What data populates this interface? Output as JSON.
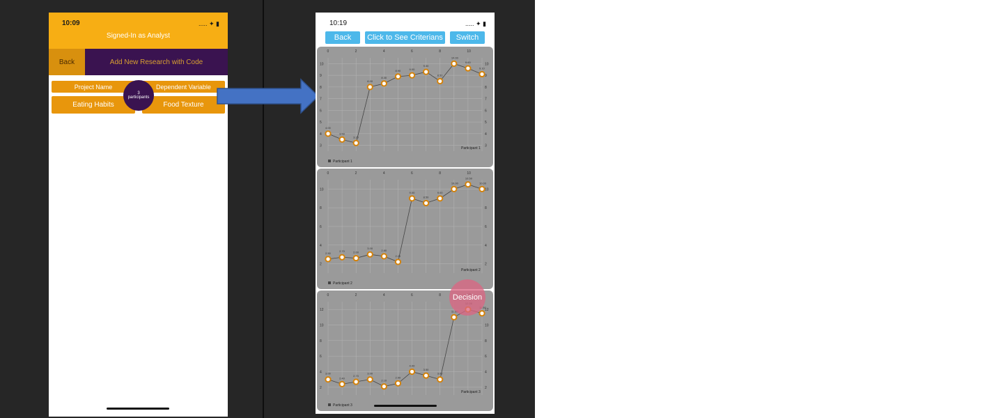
{
  "left_phone": {
    "time": "10:09",
    "status": "..... ✦ ▮",
    "header_title": "Signed-In as Analyst",
    "back_label": "Back",
    "add_label": "Add New Research with Code",
    "table": {
      "col1_header": "Project Name",
      "col2_header": "Dependent Variable",
      "col1_value": "Eating Habits",
      "col2_value": "Food Texture"
    },
    "badge": {
      "count": "3",
      "label": "participants"
    }
  },
  "right_phone": {
    "time": "10:19",
    "status": "..... ✦ ▮",
    "buttons": {
      "back": "Back",
      "criterians": "Click to See Criterians",
      "switch": "Switch"
    },
    "decision_label": "Decision"
  },
  "colors": {
    "accent_orange": "#f7ae14",
    "purple": "#3a1350",
    "button_blue": "#4db8ea",
    "point_orange": "#e8960c"
  },
  "chart_data": [
    {
      "type": "line",
      "x": [
        0,
        1,
        2,
        3,
        4,
        5,
        6,
        7,
        8,
        9,
        10,
        11
      ],
      "x_ticks": [
        "0",
        "2",
        "4",
        "6",
        "8",
        "10"
      ],
      "y_ticks_left": [
        "10",
        "9",
        "8",
        "7",
        "6",
        "5",
        "4",
        "3"
      ],
      "y_ticks_right": [
        "10",
        "9",
        "8",
        "7",
        "6",
        "5",
        "4",
        "3"
      ],
      "ylim": [
        2.5,
        10.5
      ],
      "series": [
        {
          "name": "Participant 1",
          "values": [
            4.0,
            3.5,
            3.2,
            8.0,
            8.3,
            8.9,
            9.0,
            9.3,
            8.5,
            10.0,
            9.6,
            9.1
          ]
        }
      ],
      "corner_label": "Participant 1",
      "legend": "Participant 1"
    },
    {
      "type": "line",
      "x": [
        0,
        1,
        2,
        3,
        4,
        5,
        6,
        7,
        8,
        9,
        10,
        11
      ],
      "x_ticks": [
        "0",
        "2",
        "4",
        "6",
        "8",
        "10"
      ],
      "y_ticks_left": [
        "10",
        "8",
        "6",
        "4",
        "2"
      ],
      "y_ticks_right": [
        "10",
        "8",
        "6",
        "4",
        "2"
      ],
      "ylim": [
        1,
        11
      ],
      "series": [
        {
          "name": "Participant 2",
          "values": [
            2.5,
            2.7,
            2.6,
            3.0,
            2.8,
            2.2,
            9.0,
            8.5,
            9.0,
            10.0,
            10.5,
            10.0
          ]
        }
      ],
      "corner_label": "Participant 2",
      "legend": "Participant 2"
    },
    {
      "type": "line",
      "x": [
        0,
        1,
        2,
        3,
        4,
        5,
        6,
        7,
        8,
        9,
        10,
        11
      ],
      "x_ticks": [
        "0",
        "2",
        "4",
        "6",
        "8",
        "10"
      ],
      "y_ticks_left": [
        "12",
        "10",
        "8",
        "6",
        "4",
        "2"
      ],
      "y_ticks_right": [
        "12",
        "10",
        "8",
        "6",
        "4",
        "2"
      ],
      "ylim": [
        1,
        13
      ],
      "series": [
        {
          "name": "Participant 3",
          "values": [
            3.0,
            2.4,
            2.7,
            3.0,
            2.1,
            2.5,
            4.0,
            3.5,
            3.0,
            11.0,
            12.0,
            11.5
          ]
        }
      ],
      "corner_label": "Participant 3",
      "legend": "Participant 3"
    }
  ]
}
